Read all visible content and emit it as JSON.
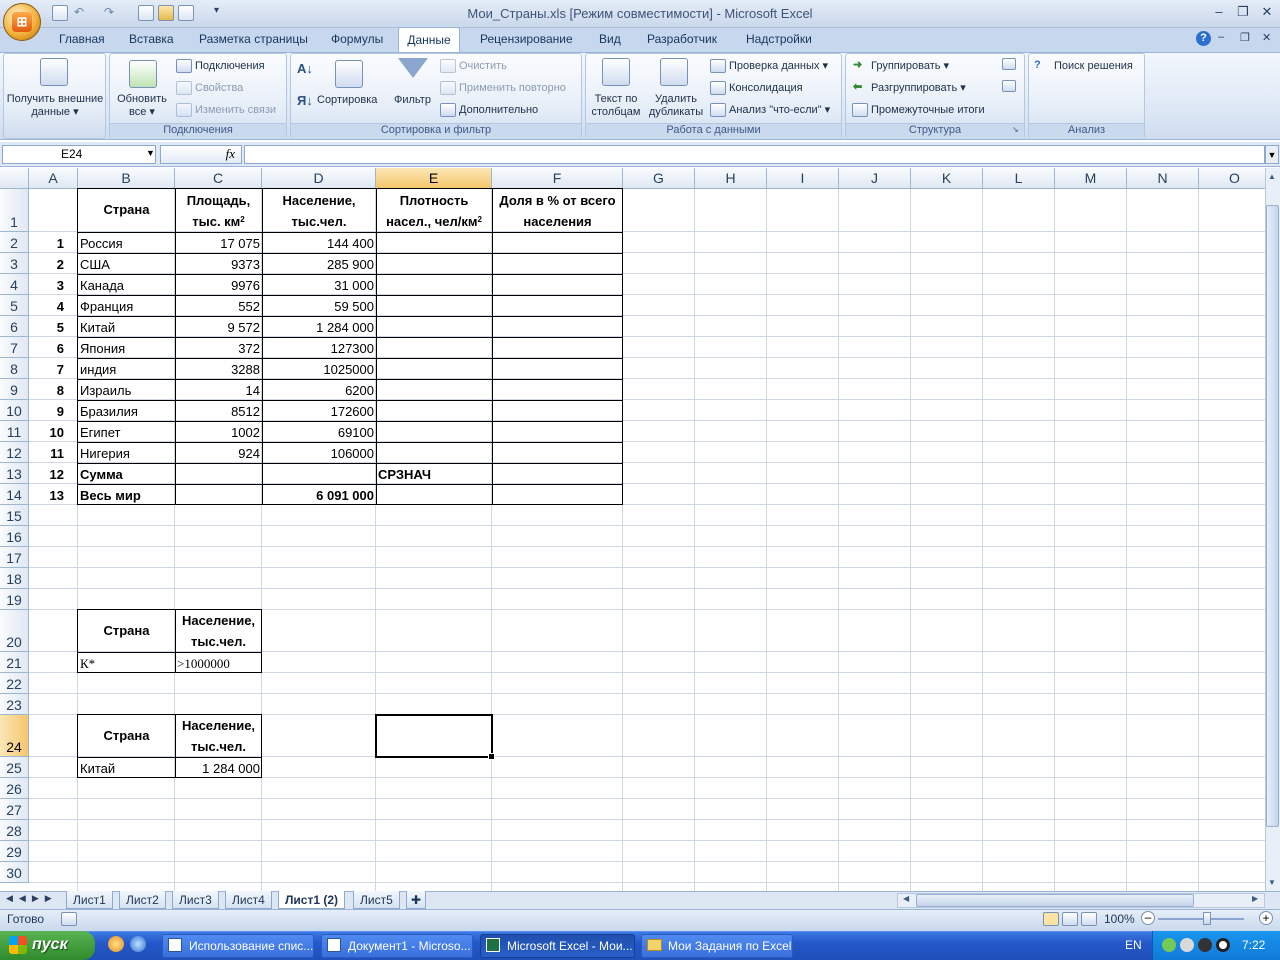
{
  "window": {
    "title": "Мои_Страны.xls  [Режим совместимости] - Microsoft Excel"
  },
  "ribbon_tabs": [
    "Главная",
    "Вставка",
    "Разметка страницы",
    "Формулы",
    "Данные",
    "Рецензирование",
    "Вид",
    "Разработчик",
    "Надстройки"
  ],
  "ribbon": {
    "get_external": "Получить внешние данные",
    "refresh_all": "Обновить все",
    "connections": "Подключения",
    "properties": "Свойства",
    "edit_links": "Изменить связи",
    "group_connections": "Подключения",
    "sort": "Сортировка",
    "filter": "Фильтр",
    "clear": "Очистить",
    "reapply": "Применить повторно",
    "advanced": "Дополнительно",
    "group_sort": "Сортировка и фильтр",
    "text_to_columns": "Текст по столбцам",
    "remove_duplicates": "Удалить дубликаты",
    "data_validation": "Проверка данных",
    "consolidate": "Консолидация",
    "what_if": "Анализ \"что-если\"",
    "group_data": "Работа с данными",
    "group_btn": "Группировать",
    "ungroup_btn": "Разгруппировать",
    "subtotal": "Промежуточные итоги",
    "group_outline": "Структура",
    "solver": "Поиск решения",
    "group_analysis": "Анализ"
  },
  "formula_bar": {
    "name_box": "E24",
    "fx": "fx",
    "formula": ""
  },
  "columns": [
    "A",
    "B",
    "C",
    "D",
    "E",
    "F",
    "G",
    "H",
    "I",
    "J",
    "K",
    "L",
    "M",
    "N",
    "O"
  ],
  "rows": [
    "1",
    "2",
    "3",
    "4",
    "5",
    "6",
    "7",
    "8",
    "9",
    "10",
    "11",
    "12",
    "13",
    "14",
    "15",
    "16",
    "17",
    "18",
    "19",
    "20",
    "21",
    "22",
    "23",
    "24",
    "25",
    "26",
    "27",
    "28",
    "29",
    "30"
  ],
  "table": {
    "headers": {
      "country": "Страна",
      "area_1": "Площадь,",
      "area_2": "тыс. км",
      "area_sup": "2",
      "pop_1": "Население,",
      "pop_2": "тыс.чел.",
      "dens_1": "Плотность",
      "dens_2": "насел., чел/км",
      "dens_sup": "2",
      "share_1": "Доля в % от всего",
      "share_2": "населения"
    },
    "rows": [
      {
        "n": "1",
        "country": "Россия",
        "area": "17 075",
        "pop": "144 400"
      },
      {
        "n": "2",
        "country": "США",
        "area": "9373",
        "pop": "285 900"
      },
      {
        "n": "3",
        "country": "Канада",
        "area": "9976",
        "pop": "31 000"
      },
      {
        "n": "4",
        "country": "Франция",
        "area": "552",
        "pop": "59 500"
      },
      {
        "n": "5",
        "country": "Китай",
        "area": "9 572",
        "pop": "1 284 000"
      },
      {
        "n": "6",
        "country": "Япония",
        "area": "372",
        "pop": "127300"
      },
      {
        "n": "7",
        "country": "индия",
        "area": "3288",
        "pop": "1025000"
      },
      {
        "n": "8",
        "country": "Израиль",
        "area": "14",
        "pop": "6200"
      },
      {
        "n": "9",
        "country": "Бразилия",
        "area": "8512",
        "pop": "172600"
      },
      {
        "n": "10",
        "country": "Египет",
        "area": "1002",
        "pop": "69100"
      },
      {
        "n": "11",
        "country": "Нигерия",
        "area": "924",
        "pop": "106000"
      }
    ],
    "sum_row": {
      "n": "12",
      "label": "Сумма",
      "e": "СРЗНАЧ"
    },
    "world_row": {
      "n": "13",
      "label": "Весь мир",
      "pop": "6 091 000"
    }
  },
  "criteria": {
    "h_country": "Страна",
    "h_pop_1": "Население,",
    "h_pop_2": "тыс.чел.",
    "country": "К*",
    "pop": ">1000000"
  },
  "result": {
    "h_country": "Страна",
    "h_pop_1": "Население,",
    "h_pop_2": "тыс.чел.",
    "country": "Китай",
    "pop": "1 284 000"
  },
  "sheets": [
    "Лист1",
    "Лист2",
    "Лист3",
    "Лист4",
    "Лист1 (2)",
    "Лист5"
  ],
  "status": {
    "ready": "Готово",
    "zoom": "100%"
  },
  "taskbar": {
    "start": "пуск",
    "tasks": [
      "Использование спис...",
      "Документ1 - Microso...",
      "Microsoft Excel - Мои...",
      "Мои Задания по Excel"
    ],
    "lang": "EN",
    "clock": "7:22"
  }
}
